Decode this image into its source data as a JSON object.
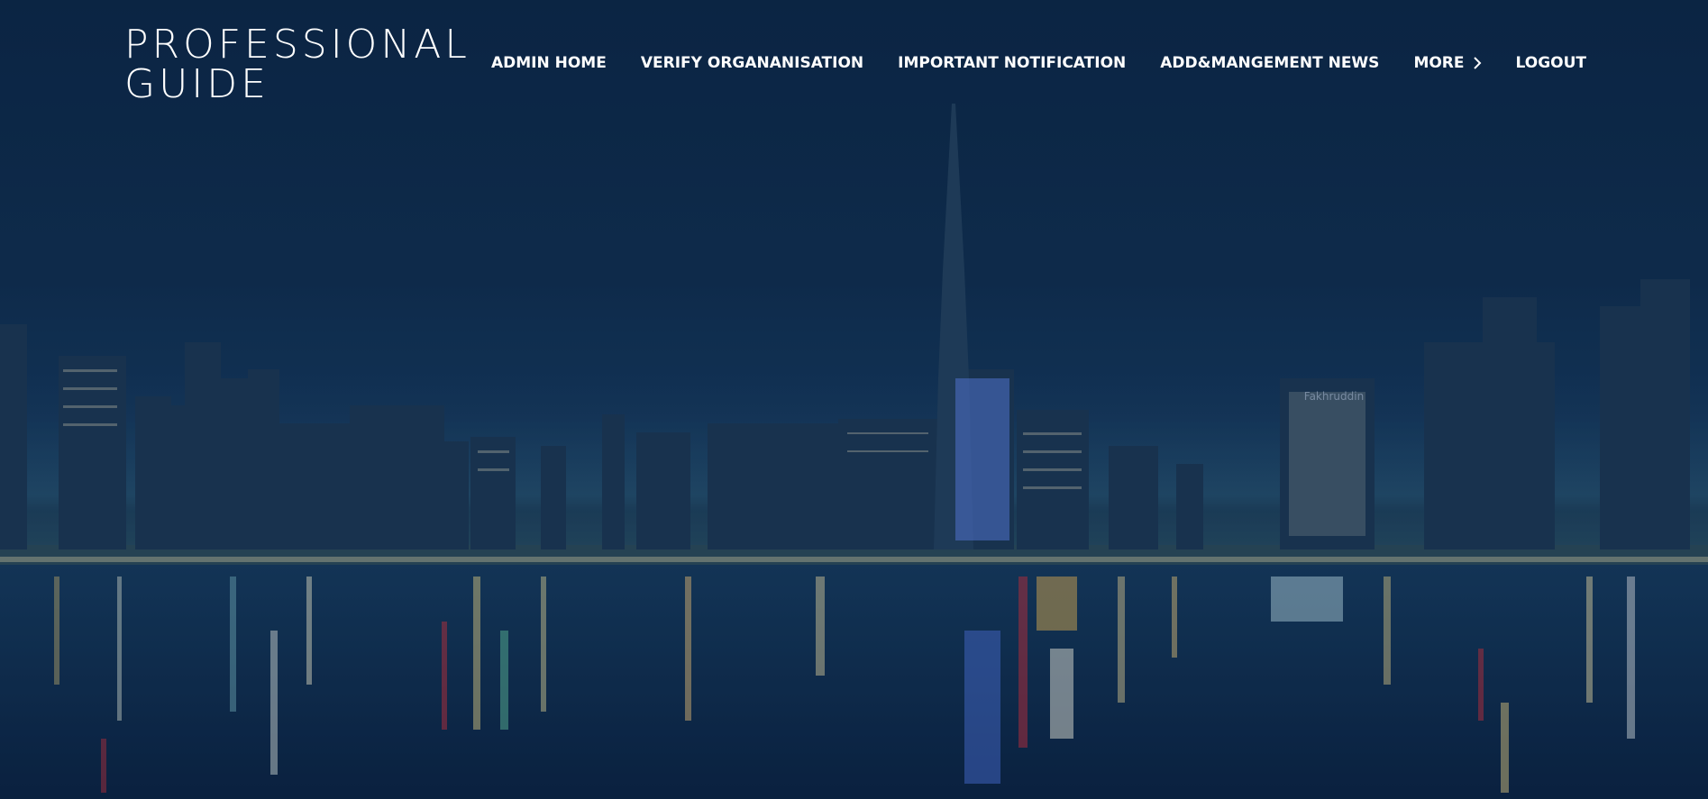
{
  "brand": {
    "line1": "PROFESSIONAL",
    "line2": "GUIDE"
  },
  "nav": {
    "items": [
      {
        "label": "ADMIN HOME"
      },
      {
        "label": "VERIFY ORGANANISATION"
      },
      {
        "label": "IMPORTANT NOTIFICATION"
      },
      {
        "label": "ADD&MANGEMENT NEWS"
      },
      {
        "label": "MORE",
        "icon": "chevron-right-icon"
      },
      {
        "label": "LOGOUT"
      }
    ]
  },
  "hero": {
    "background": "night city skyline with water reflection",
    "sign_text": "Fakhruddin"
  },
  "colors": {
    "sky_top": "#0c2645",
    "horizon": "#1c4468",
    "water": "#0b2544",
    "text": "#ffffff"
  }
}
